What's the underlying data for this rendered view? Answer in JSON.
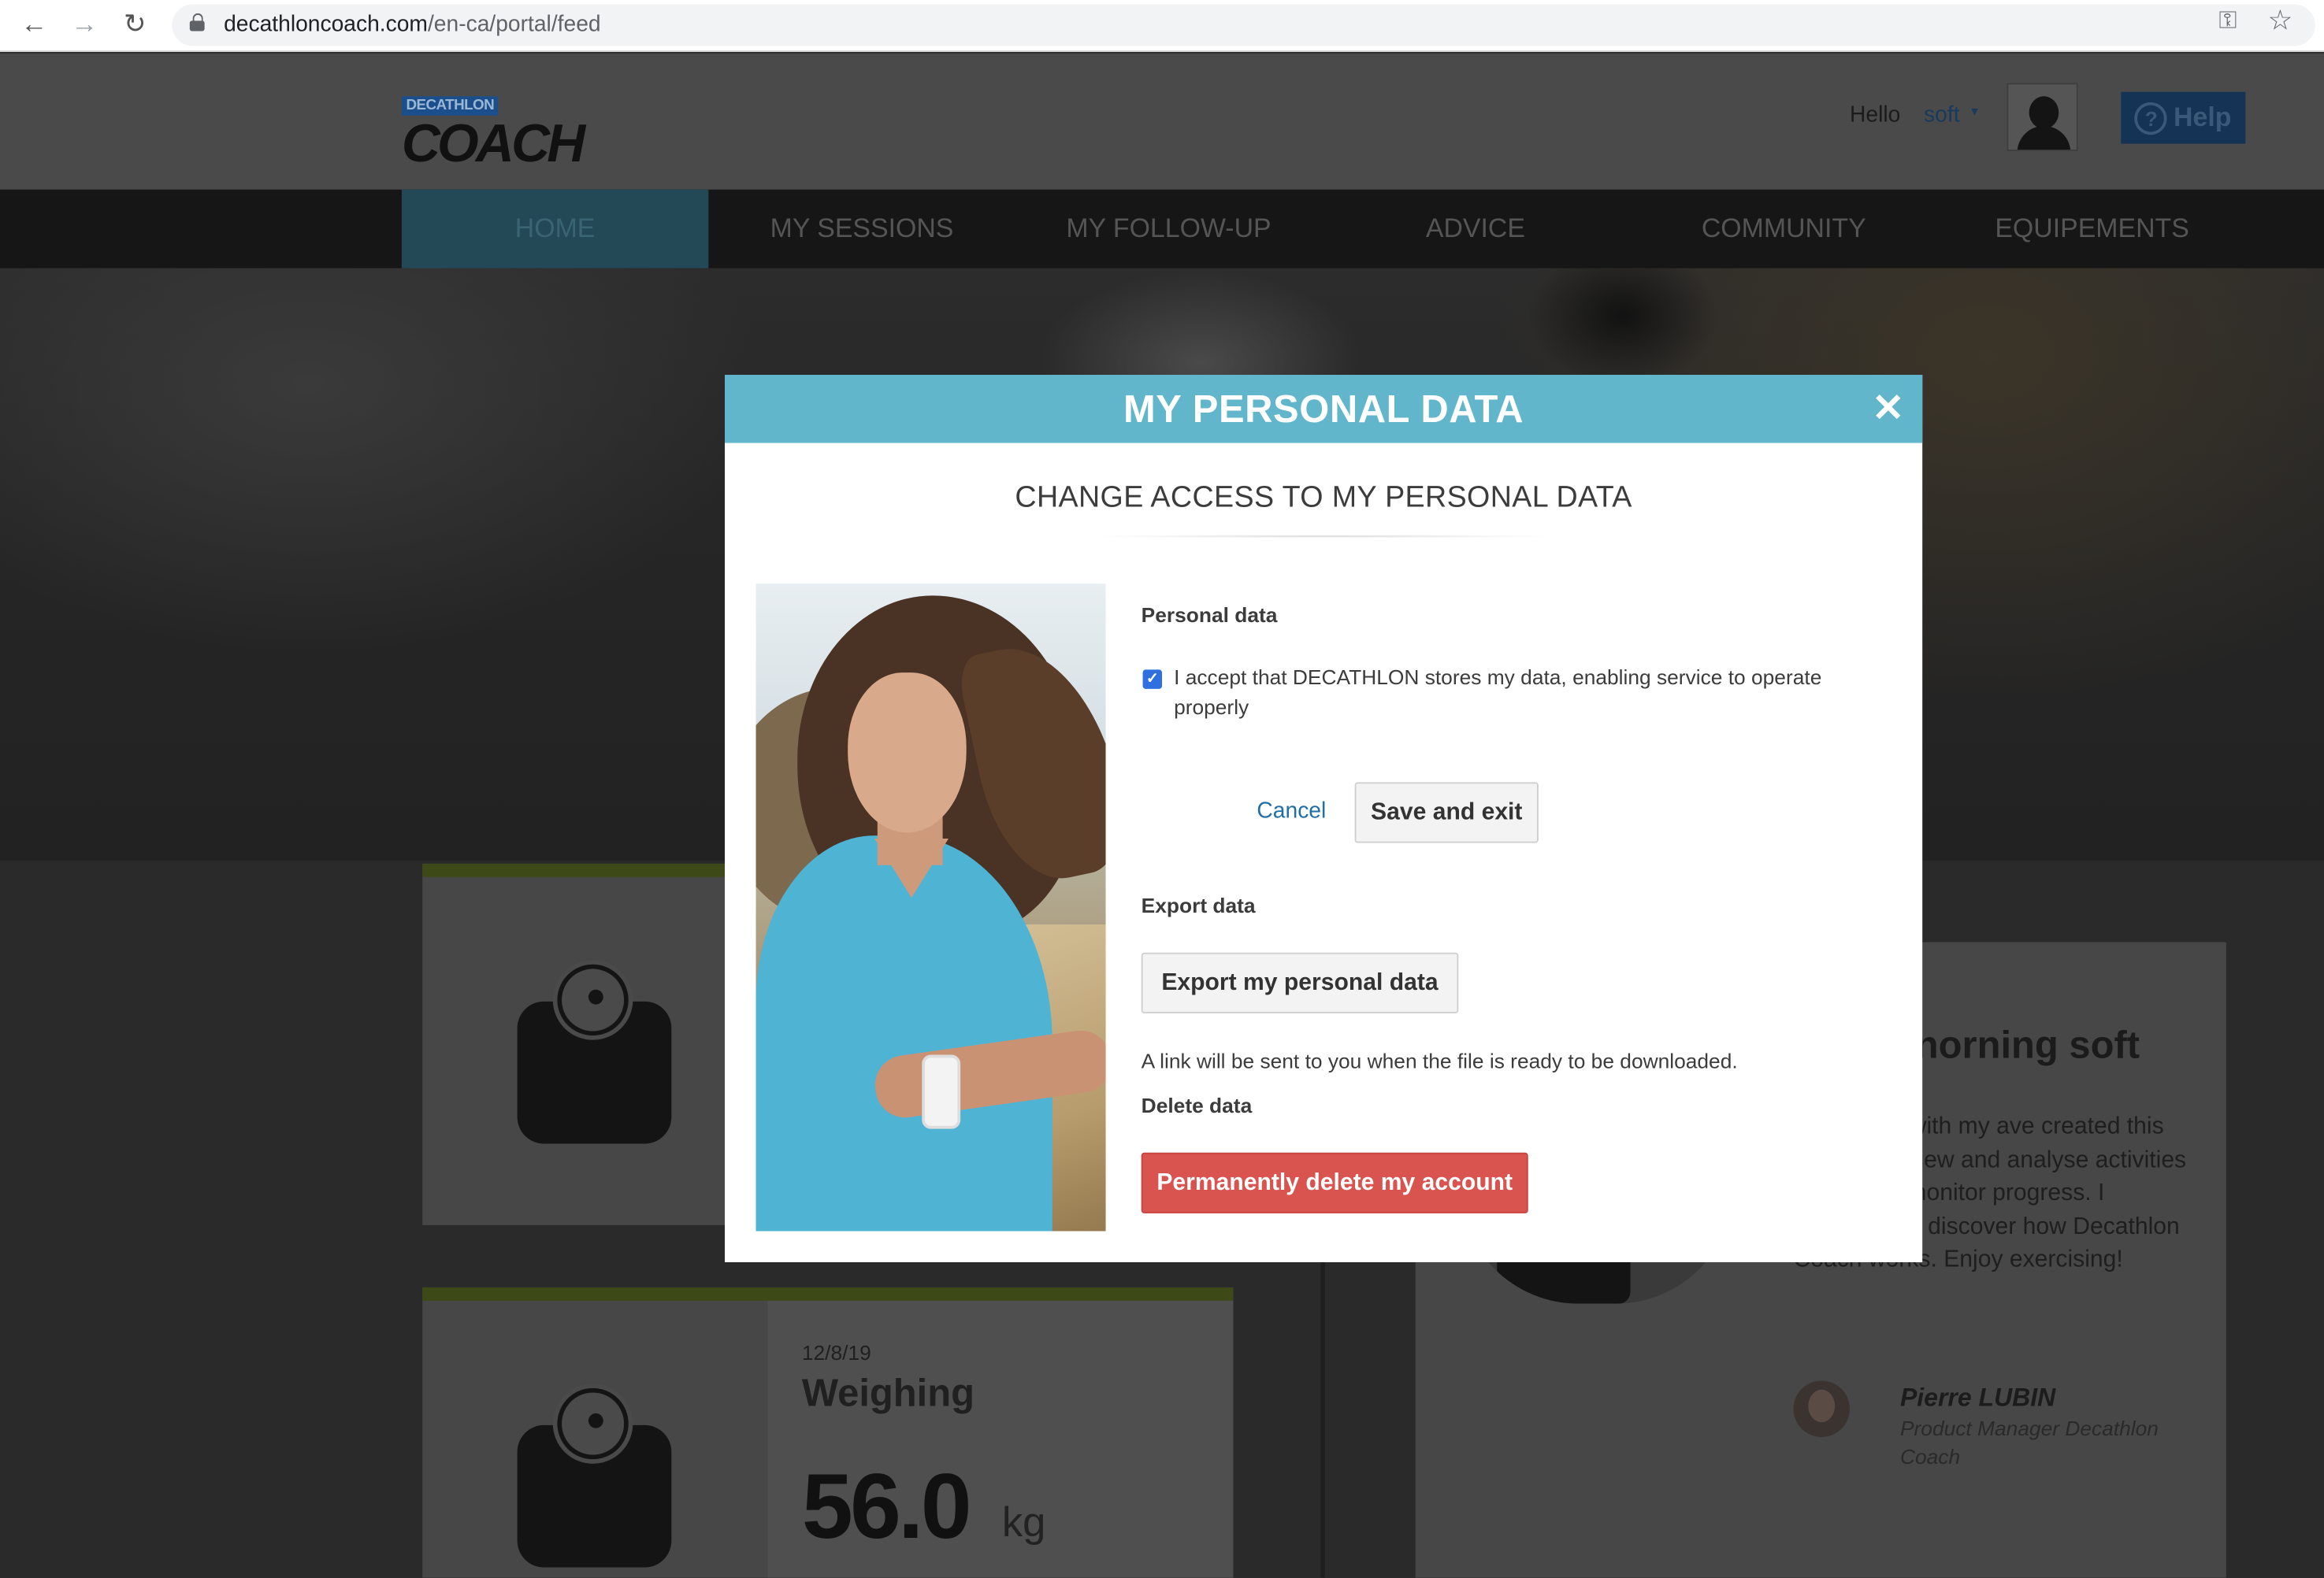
{
  "browser": {
    "url_host": "decathloncoach.com",
    "url_path": "/en-ca/portal/feed",
    "back_icon": "←",
    "forward_icon": "→",
    "reload_icon": "↻",
    "key_icon": "⚿",
    "star_icon": "☆"
  },
  "header": {
    "logo_top": "DECATHLON",
    "logo_main": "COACH",
    "greeting": "Hello",
    "username": "soft",
    "dropdown_icon": "▾",
    "help_label": "Help",
    "help_icon": "?"
  },
  "nav": {
    "items": [
      "HOME",
      "MY SESSIONS",
      "MY FOLLOW-UP",
      "ADVICE",
      "COMMUNITY",
      "EQUIPEMENTS"
    ],
    "active": "HOME"
  },
  "feed": {
    "weighing": {
      "date": "12/8/19",
      "title": "Weighing",
      "value": "56.0",
      "unit": "kg"
    },
    "welcome": {
      "greeting": "norning soft",
      "text": "Pierre and with my ave created this website to view and analyse activities in order to monitor progress. I suggest you discover how Decathlon Coach works. Enjoy exercising!",
      "author_name": "Pierre LUBIN",
      "author_role": "Product Manager Decathlon Coach"
    }
  },
  "modal": {
    "title": "MY PERSONAL DATA",
    "close_icon": "✕",
    "subtitle": "CHANGE ACCESS TO MY PERSONAL DATA",
    "personal_data_label": "Personal data",
    "accept_checked": true,
    "check_icon": "✓",
    "accept_text": "I accept that DECATHLON stores my data, enabling service to operate properly",
    "cancel_label": "Cancel",
    "save_label": "Save and exit",
    "export_label": "Export data",
    "export_button": "Export my personal data",
    "export_note": "A link will be sent to you when the file is ready to be downloaded.",
    "delete_label": "Delete data",
    "delete_button": "Permanently delete my account"
  },
  "colors": {
    "modal_header": "#62b6cb",
    "delete_button": "#d9534f",
    "link": "#1f6fa5",
    "checkbox": "#2f6fe0"
  }
}
